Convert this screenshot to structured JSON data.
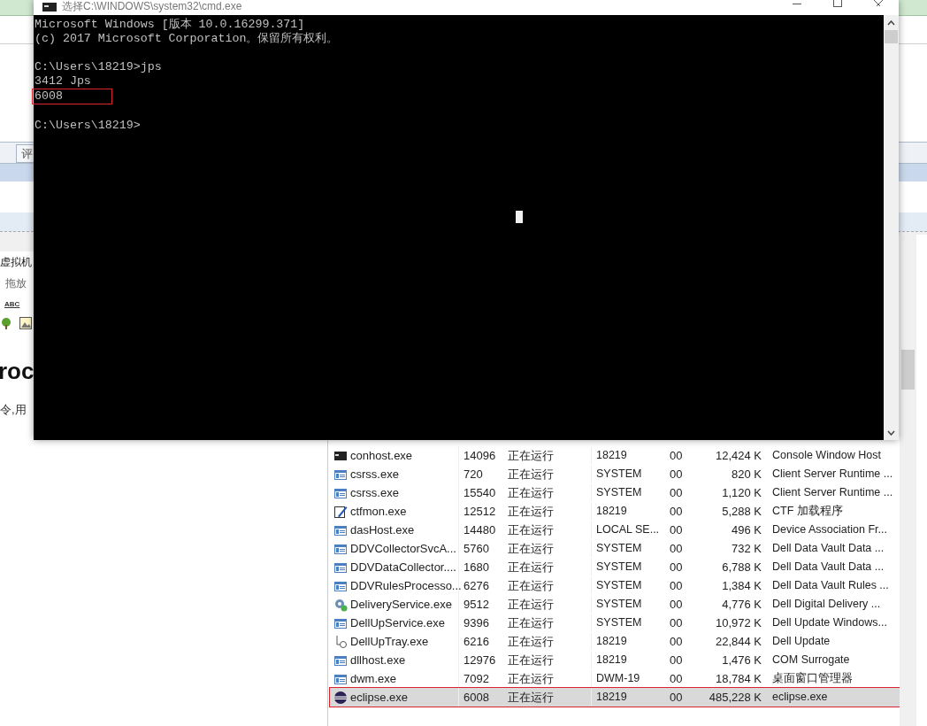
{
  "background_window": {
    "tab": "评",
    "field": "虚拟机",
    "hint": "拖放",
    "toolbar_label": "ABC",
    "heading": "roc",
    "paragraph": "令,用"
  },
  "console": {
    "title": "选择C:\\WINDOWS\\system32\\cmd.exe",
    "lines": [
      {
        "text": "Microsoft Windows [版本 10.0.16299.371]",
        "blank_before": false,
        "highlighted": false
      },
      {
        "text": "(c) 2017 Microsoft Corporation。保留所有权利。",
        "blank_before": false,
        "highlighted": false
      },
      {
        "text": "C:\\Users\\18219>jps",
        "blank_before": true,
        "highlighted": false
      },
      {
        "text": "3412 Jps",
        "blank_before": false,
        "highlighted": false
      },
      {
        "text": "6008",
        "blank_before": false,
        "highlighted": true
      },
      {
        "text": "C:\\Users\\18219>",
        "blank_before": true,
        "highlighted": false
      }
    ]
  },
  "task_manager": {
    "rows": [
      {
        "kind": "console",
        "name": "conhost.exe",
        "pid": "14096",
        "status": "正在运行",
        "user": "18219",
        "cpu": "00",
        "memory": "12,424 K",
        "description": "Console Window Host",
        "selected": false,
        "highlighted": false
      },
      {
        "kind": "window",
        "name": "csrss.exe",
        "pid": "720",
        "status": "正在运行",
        "user": "SYSTEM",
        "cpu": "00",
        "memory": "820 K",
        "description": "Client Server Runtime ...",
        "selected": false,
        "highlighted": false
      },
      {
        "kind": "window",
        "name": "csrss.exe",
        "pid": "15540",
        "status": "正在运行",
        "user": "SYSTEM",
        "cpu": "00",
        "memory": "1,120 K",
        "description": "Client Server Runtime ...",
        "selected": false,
        "highlighted": false
      },
      {
        "kind": "pen",
        "name": "ctfmon.exe",
        "pid": "12512",
        "status": "正在运行",
        "user": "18219",
        "cpu": "00",
        "memory": "5,288 K",
        "description": "CTF 加载程序",
        "selected": false,
        "highlighted": false
      },
      {
        "kind": "window",
        "name": "dasHost.exe",
        "pid": "14480",
        "status": "正在运行",
        "user": "LOCAL SE...",
        "cpu": "00",
        "memory": "496 K",
        "description": "Device Association Fr...",
        "selected": false,
        "highlighted": false
      },
      {
        "kind": "window",
        "name": "DDVCollectorSvcA...",
        "pid": "5760",
        "status": "正在运行",
        "user": "SYSTEM",
        "cpu": "00",
        "memory": "732 K",
        "description": "Dell Data Vault Data ...",
        "selected": false,
        "highlighted": false
      },
      {
        "kind": "window",
        "name": "DDVDataCollector....",
        "pid": "1680",
        "status": "正在运行",
        "user": "SYSTEM",
        "cpu": "00",
        "memory": "6,788 K",
        "description": "Dell Data Vault Data ...",
        "selected": false,
        "highlighted": false
      },
      {
        "kind": "window",
        "name": "DDVRulesProcesso...",
        "pid": "6276",
        "status": "正在运行",
        "user": "SYSTEM",
        "cpu": "00",
        "memory": "1,384 K",
        "description": "Dell Data Vault Rules ...",
        "selected": false,
        "highlighted": false
      },
      {
        "kind": "gear",
        "name": "DeliveryService.exe",
        "pid": "9512",
        "status": "正在运行",
        "user": "SYSTEM",
        "cpu": "00",
        "memory": "4,776 K",
        "description": "Dell Digital Delivery ...",
        "selected": false,
        "highlighted": false
      },
      {
        "kind": "window",
        "name": "DellUpService.exe",
        "pid": "9396",
        "status": "正在运行",
        "user": "SYSTEM",
        "cpu": "00",
        "memory": "10,972 K",
        "description": "Dell Update Windows...",
        "selected": false,
        "highlighted": false
      },
      {
        "kind": "tray",
        "name": "DellUpTray.exe",
        "pid": "6216",
        "status": "正在运行",
        "user": "18219",
        "cpu": "00",
        "memory": "22,844 K",
        "description": "Dell Update",
        "selected": false,
        "highlighted": false
      },
      {
        "kind": "window",
        "name": "dllhost.exe",
        "pid": "12976",
        "status": "正在运行",
        "user": "18219",
        "cpu": "00",
        "memory": "1,476 K",
        "description": "COM Surrogate",
        "selected": false,
        "highlighted": false
      },
      {
        "kind": "window",
        "name": "dwm.exe",
        "pid": "7092",
        "status": "正在运行",
        "user": "DWM-19",
        "cpu": "00",
        "memory": "18,784 K",
        "description": "桌面窗口管理器",
        "selected": false,
        "highlighted": false
      },
      {
        "kind": "eclipse",
        "name": "eclipse.exe",
        "pid": "6008",
        "status": "正在运行",
        "user": "18219",
        "cpu": "00",
        "memory": "485,228 K",
        "description": "eclipse.exe",
        "selected": true,
        "highlighted": true
      }
    ]
  }
}
